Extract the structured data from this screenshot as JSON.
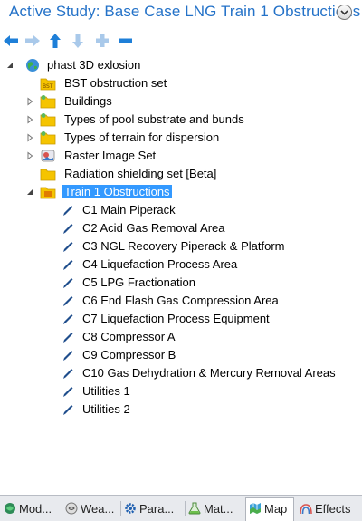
{
  "header": {
    "title": "Active Study: Base Case LNG Train 1 Obstructions"
  },
  "toolbar": {
    "icons": [
      "back-arrow-icon",
      "forward-arrow-icon",
      "up-arrow-icon",
      "down-arrow-icon",
      "add-icon",
      "remove-icon"
    ]
  },
  "tree": {
    "root": {
      "label": "phast 3D exlosion"
    },
    "items": [
      {
        "label": "BST obstruction set"
      },
      {
        "label": "Buildings"
      },
      {
        "label": "Types of pool substrate and bunds"
      },
      {
        "label": "Types of terrain for dispersion"
      },
      {
        "label": "Raster Image Set"
      },
      {
        "label": "Radiation shielding set [Beta]"
      },
      {
        "label": "Train 1 Obstructions"
      }
    ],
    "children": [
      {
        "label": "C1 Main Piperack"
      },
      {
        "label": "C2 Acid Gas Removal Area"
      },
      {
        "label": "C3 NGL Recovery Piperack & Platform"
      },
      {
        "label": "C4 Liquefaction Process Area"
      },
      {
        "label": "C5 LPG Fractionation"
      },
      {
        "label": "C6 End Flash Gas Compression Area"
      },
      {
        "label": "C7 Liquefaction Process Equipment"
      },
      {
        "label": "C8 Compressor A"
      },
      {
        "label": "C9 Compressor B"
      },
      {
        "label": "C10 Gas Dehydration & Mercury Removal Areas"
      },
      {
        "label": "Utilities 1"
      },
      {
        "label": "Utilities 2"
      }
    ]
  },
  "tabs": [
    {
      "label": "Mod..."
    },
    {
      "label": "Wea..."
    },
    {
      "label": "Para..."
    },
    {
      "label": "Mat..."
    },
    {
      "label": "Map"
    },
    {
      "label": "Effects"
    }
  ],
  "colors": {
    "title": "#2472c8",
    "selection": "#3399ff",
    "folder": "#f5c400",
    "toolbar_blue": "#1e7fd8"
  }
}
